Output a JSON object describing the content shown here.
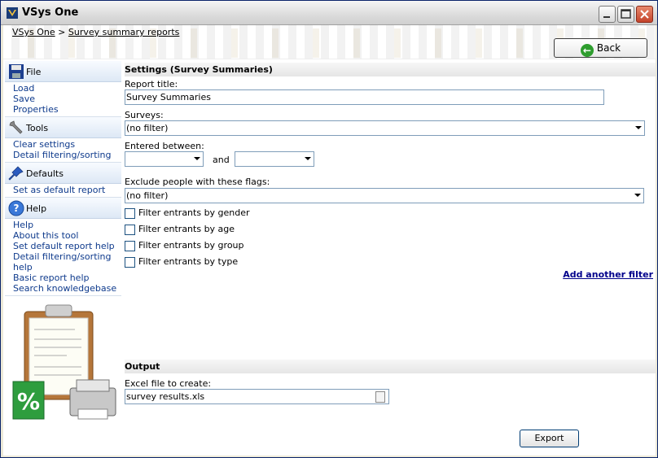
{
  "window": {
    "title": "VSys One"
  },
  "breadcrumb": {
    "root": "VSys One",
    "separator": ">",
    "current": "Survey summary reports"
  },
  "back_label": "Back",
  "sidebar": {
    "file": {
      "title": "File",
      "items": [
        "Load",
        "Save",
        "Properties"
      ]
    },
    "tools": {
      "title": "Tools",
      "items": [
        "Clear settings",
        "Detail filtering/sorting"
      ]
    },
    "defaults": {
      "title": "Defaults",
      "items": [
        "Set as default report"
      ]
    },
    "help": {
      "title": "Help",
      "items": [
        "Help",
        "About this tool",
        "Set default report help",
        "Detail filtering/sorting help",
        "Basic report help",
        "Search knowledgebase"
      ]
    }
  },
  "settings": {
    "heading": "Settings (Survey Summaries)",
    "report_title_label": "Report title:",
    "report_title_value": "Survey Summaries",
    "surveys_label": "Surveys:",
    "surveys_value": "(no filter)",
    "entered_between_label": "Entered between:",
    "and_label": "and",
    "exclude_label": "Exclude people with these flags:",
    "exclude_value": "(no filter)",
    "filters": [
      "Filter entrants by gender",
      "Filter entrants by age",
      "Filter entrants by group",
      "Filter entrants by type"
    ],
    "add_filter": "Add another filter"
  },
  "output": {
    "heading": "Output",
    "excel_label": "Excel file to create:",
    "excel_value": "survey results.xls",
    "export_label": "Export"
  },
  "colors": {
    "link": "#0e3a8c",
    "add_filter": "#00008b",
    "back_icon": "#2e9d2e",
    "close_button": "#c4432a"
  }
}
